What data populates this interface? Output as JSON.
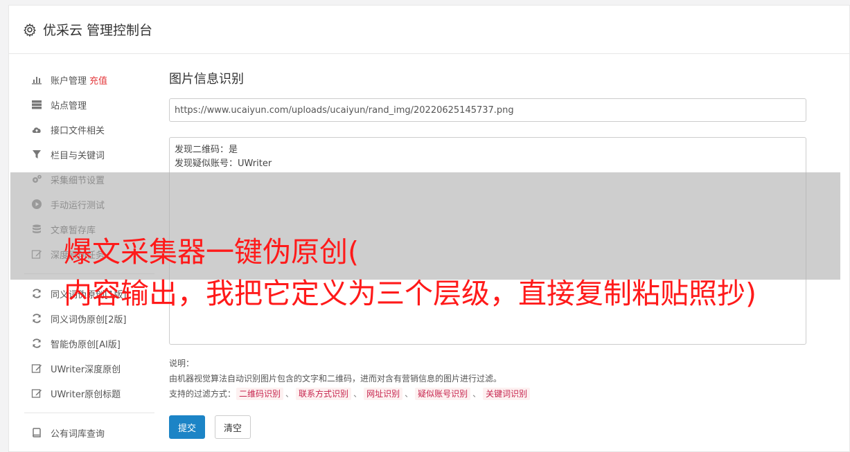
{
  "header": {
    "title": "优采云 管理控制台",
    "icon": "gear-icon"
  },
  "sidebar": {
    "group1": [
      {
        "label": "账户管理",
        "badge": "充值",
        "icon": "bar-chart-icon"
      },
      {
        "label": "站点管理",
        "icon": "server-icon"
      },
      {
        "label": "接口文件相关",
        "icon": "cloud-upload-icon"
      },
      {
        "label": "栏目与关键词",
        "icon": "filter-icon"
      },
      {
        "label": "采集细节设置",
        "icon": "cogs-icon"
      },
      {
        "label": "手动运行测试",
        "icon": "play-circle-icon"
      },
      {
        "label": "文章暂存库",
        "icon": "database-icon"
      },
      {
        "label": "深度原创任务",
        "icon": "edit-icon"
      }
    ],
    "group2": [
      {
        "label": "同义词伪原创[1版]",
        "icon": "refresh-icon"
      },
      {
        "label": "同义词伪原创[2版]",
        "icon": "refresh-icon"
      },
      {
        "label": "智能伪原创[AI版]",
        "icon": "refresh-icon"
      },
      {
        "label": "UWriter深度原创",
        "icon": "edit-icon"
      },
      {
        "label": "UWriter原创标题",
        "icon": "edit-icon"
      }
    ],
    "group3": [
      {
        "label": "公有词库查询",
        "icon": "book-icon"
      }
    ]
  },
  "main": {
    "title": "图片信息识别",
    "url_value": "https://www.ucaiyun.com/uploads/ucaiyun/rand_img/20220625145737.png",
    "result_text": "发现二维码：是\n发现疑似账号：UWriter",
    "notes": {
      "heading": "说明：",
      "description": "由机器视觉算法自动识别图片包含的文字和二维码，进而对含有营销信息的图片进行过滤。",
      "filter_label": "支持的过滤方式：",
      "filters": [
        "二维码识别",
        "联系方式识别",
        "网址识别",
        "疑似账号识别",
        "关键词识别"
      ],
      "separator": "、"
    },
    "buttons": {
      "submit": "提交",
      "clear": "清空"
    }
  },
  "overlay": {
    "line1": "爆文采集器一键伪原创(",
    "line2": "内容输出，我把它定义为三个层级，直接复制粘贴照抄)"
  },
  "colors": {
    "accent": "#1c84c6",
    "badge": "#e4393c",
    "overlay_text": "#ff1a1a",
    "tag_text": "#c7254e"
  }
}
